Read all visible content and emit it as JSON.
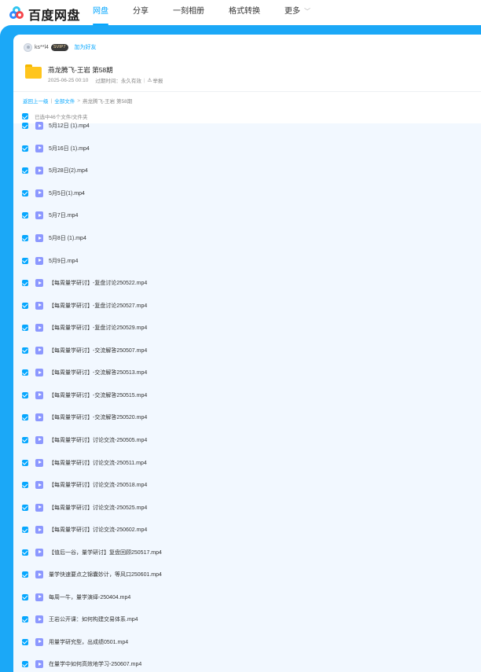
{
  "app": {
    "logo_text": "百度网盘",
    "nav": [
      {
        "label": "网盘",
        "active": true
      },
      {
        "label": "分享",
        "active": false
      },
      {
        "label": "一刻相册",
        "active": false
      },
      {
        "label": "格式转换",
        "active": false
      },
      {
        "label": "更多",
        "active": false
      }
    ],
    "accent_color": "#06a7ff"
  },
  "share": {
    "username": "ks**l4",
    "vip_badge": "SVIP7",
    "add_friend": "加为好友",
    "title": "燕龙腾飞-王岩 第58期",
    "date": "2025-06-25 00:10",
    "expiry": "过期时间：永久有效",
    "report": "举报"
  },
  "breadcrumb": {
    "back": "返回上一级",
    "root": "全部文件",
    "current": "燕龙腾飞-王岩 第58期"
  },
  "selection": {
    "text": "已选中46个文件/文件夹"
  },
  "files": [
    "5月12日 (1).mp4",
    "5月16日 (1).mp4",
    "5月28日(2).mp4",
    "5月5日(1).mp4",
    "5月7日.mp4",
    "5月8日 (1).mp4",
    "5月9日.mp4",
    "【每周量学研讨】-复盘讨论250522.mp4",
    "【每周量学研讨】-复盘讨论250527.mp4",
    "【每周量学研讨】-复盘讨论250529.mp4",
    "【每周量学研讨】-交流解答250507.mp4",
    "【每周量学研讨】-交流解答250513.mp4",
    "【每周量学研讨】-交流解答250515.mp4",
    "【每周量学研讨】-交流解答250520.mp4",
    "【每周量学研讨】讨论交流-250505.mp4",
    "【每周量学研讨】讨论交流-250511.mp4",
    "【每周量学研讨】讨论交流-250518.mp4",
    "【每周量学研讨】讨论交流-250525.mp4",
    "【每周量学研讨】讨论交流-250602.mp4",
    "【值后一谷，量学研讨】复盘回顾250517.mp4",
    "量学快速要点之锦囊妙计，等风口250601.mp4",
    "每周一牛，量学演绎-250404.mp4",
    "王岩公开课：如何构建交易体系.mp4",
    "用量学研究型，出成绩0501.mp4",
    "在量学中如何高效地学习-250607.mp4"
  ]
}
